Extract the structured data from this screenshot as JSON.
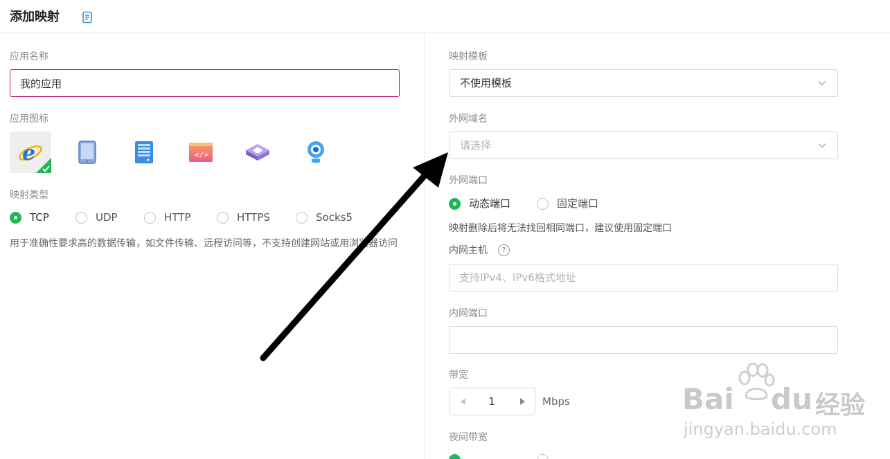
{
  "header": {
    "title": "添加映射",
    "doc_icon": "document-icon"
  },
  "left": {
    "app_name": {
      "label": "应用名称",
      "value": "我的应用"
    },
    "app_icon": {
      "label": "应用图标",
      "icons": [
        "ie-browser-icon",
        "tablet-icon",
        "server-icon",
        "code-window-icon",
        "network-device-icon",
        "webcam-icon"
      ],
      "selected_index": 0
    },
    "mapping_type": {
      "label": "映射类型",
      "options": [
        "TCP",
        "UDP",
        "HTTP",
        "HTTPS",
        "Socks5"
      ],
      "selected": "TCP",
      "description": "用于准确性要求高的数据传输，如文件传输、远程访问等，不支持创建网站或用浏览器访问"
    }
  },
  "right": {
    "template": {
      "label": "映射模板",
      "value": "不使用模板"
    },
    "domain": {
      "label": "外网域名",
      "placeholder": "请选择"
    },
    "external_port": {
      "label": "外网端口",
      "options": [
        "动态端口",
        "固定端口"
      ],
      "selected": "动态端口",
      "hint": "映射删除后将无法找回相同端口，建议使用固定端口"
    },
    "internal_host": {
      "label": "内网主机",
      "help": "?",
      "placeholder": "支持IPv4、IPv6格式地址"
    },
    "internal_port": {
      "label": "内网端口",
      "value": ""
    },
    "bandwidth": {
      "label": "带宽",
      "value": "1",
      "unit": "Mbps"
    },
    "night_bandwidth": {
      "label": "夜间带宽"
    }
  },
  "watermark": {
    "brand": "Bai",
    "brand2": "du",
    "cn": "经验",
    "url": "jingyan.baidu.com"
  },
  "colors": {
    "accent_green": "#1db954",
    "focus_border": "#c8146e",
    "arrow": "#000000"
  }
}
